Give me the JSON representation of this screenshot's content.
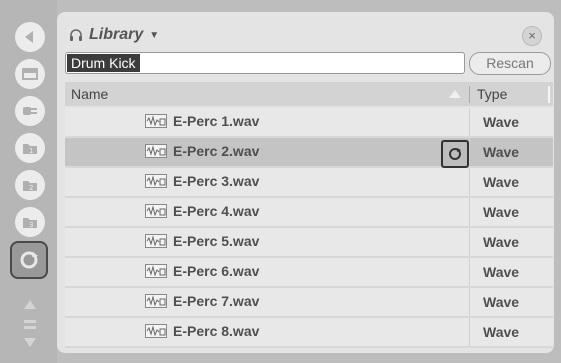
{
  "browser": {
    "title": "Library",
    "search_value": "Drum Kick",
    "rescan_label": "Rescan",
    "columns": {
      "name": "Name",
      "type": "Type"
    },
    "files": [
      {
        "name": "E-Perc 1.wav",
        "type": "Wave",
        "selected": false
      },
      {
        "name": "E-Perc 2.wav",
        "type": "Wave",
        "selected": true
      },
      {
        "name": "E-Perc 3.wav",
        "type": "Wave",
        "selected": false
      },
      {
        "name": "E-Perc 4.wav",
        "type": "Wave",
        "selected": false
      },
      {
        "name": "E-Perc 5.wav",
        "type": "Wave",
        "selected": false
      },
      {
        "name": "E-Perc 6.wav",
        "type": "Wave",
        "selected": false
      },
      {
        "name": "E-Perc 7.wav",
        "type": "Wave",
        "selected": false
      },
      {
        "name": "E-Perc 8.wav",
        "type": "Wave",
        "selected": false
      }
    ]
  },
  "sidebar": {
    "icons": [
      "back-arrow-icon",
      "window-icon",
      "plugin-icon",
      "folder-1-icon",
      "folder-2-icon",
      "folder-3-icon",
      "hotswap-icon",
      "scroll-icon"
    ]
  },
  "colors": {
    "selected_row": "#c4c4c4",
    "panel": "#e4e4e4",
    "sidebar": "#b6b6b6"
  }
}
